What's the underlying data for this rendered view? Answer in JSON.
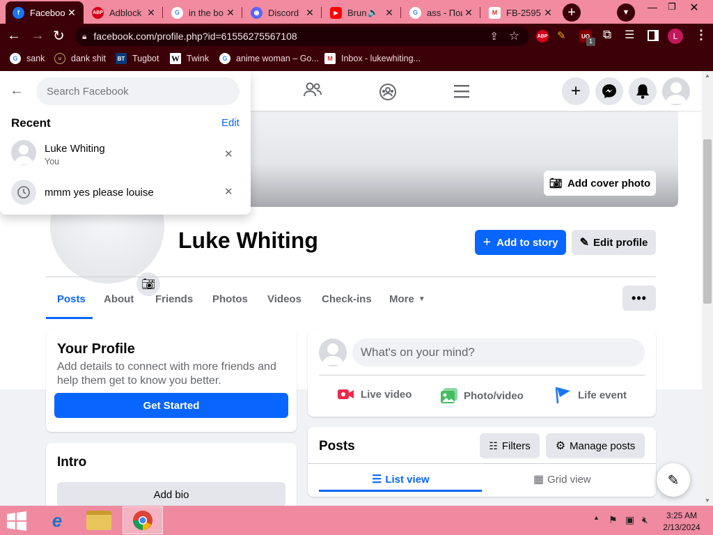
{
  "browser": {
    "tabs": [
      {
        "title": "Facebook",
        "icon": "facebook-icon",
        "active": true
      },
      {
        "title": "Adblock",
        "icon": "adblock-icon"
      },
      {
        "title": "in the bo",
        "icon": "google-icon"
      },
      {
        "title": "Discord",
        "icon": "discord-icon"
      },
      {
        "title": "Brun",
        "icon": "youtube-icon"
      },
      {
        "title": "ass - Пои",
        "icon": "google-icon"
      },
      {
        "title": "FB-2595",
        "icon": "gmail-icon"
      }
    ],
    "url": "facebook.com/profile.php?id=61556275567108",
    "bookmarks": [
      {
        "label": "sank",
        "icon": "google-icon"
      },
      {
        "label": "dank shit",
        "icon": "uol-icon"
      },
      {
        "label": "Tugbot",
        "icon": "bt-icon"
      },
      {
        "label": "Twink",
        "icon": "wikipedia-icon"
      },
      {
        "label": "anime woman – Go...",
        "icon": "google-icon"
      },
      {
        "label": "Inbox - lukewhiting...",
        "icon": "gmail-icon"
      }
    ],
    "profile_letter": "L",
    "ext_badge": "1"
  },
  "search": {
    "placeholder": "Search Facebook",
    "recent_title": "Recent",
    "edit_label": "Edit",
    "items": [
      {
        "name": "Luke Whiting",
        "sub": "You"
      },
      {
        "name": "mmm yes please louise"
      }
    ]
  },
  "profile": {
    "name": "Luke Whiting",
    "add_cover": "Add cover photo",
    "add_story": "Add to story",
    "edit_profile": "Edit profile",
    "tabs": [
      "Posts",
      "About",
      "Friends",
      "Photos",
      "Videos",
      "Check-ins",
      "More"
    ]
  },
  "your_profile": {
    "title": "Your Profile",
    "desc": "Add details to connect with more friends and help them get to know you better.",
    "button": "Get Started"
  },
  "intro": {
    "title": "Intro",
    "button": "Add bio"
  },
  "composer": {
    "placeholder": "What's on your mind?",
    "actions": [
      "Live video",
      "Photo/video",
      "Life event"
    ]
  },
  "posts": {
    "title": "Posts",
    "filters": "Filters",
    "manage": "Manage posts",
    "list_view": "List view",
    "grid_view": "Grid view"
  },
  "taskbar": {
    "time": "3:25 AM",
    "date": "2/13/2024"
  },
  "colors": {
    "accent": "#0866ff",
    "chrome": "#3c0008",
    "tabstrip": "#f28ba0"
  }
}
